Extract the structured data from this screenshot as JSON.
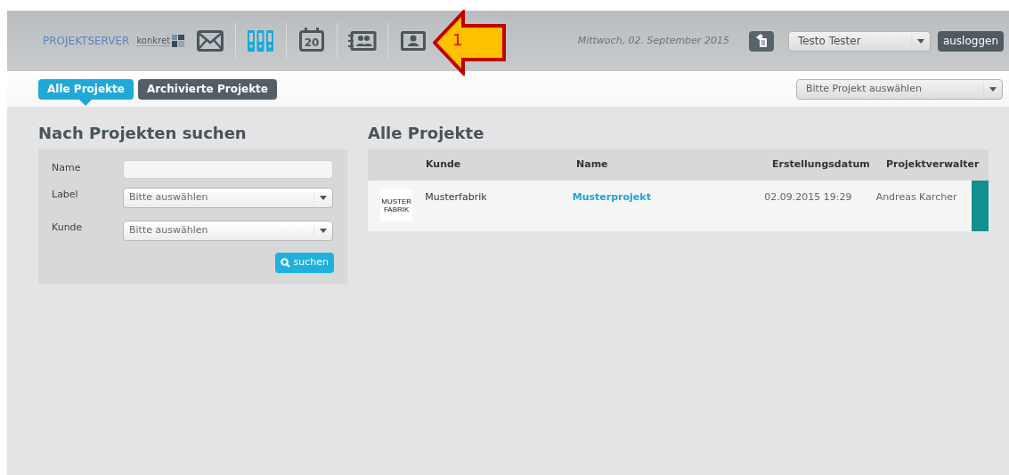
{
  "header": {
    "brand": "PROJEKTSERVER",
    "brand_logo": "konkret",
    "nav": [
      {
        "kind": "mail",
        "selected": false
      },
      {
        "kind": "binders",
        "selected": true
      },
      {
        "kind": "calendar",
        "label": "20",
        "selected": false
      },
      {
        "kind": "contacts",
        "selected": false
      },
      {
        "kind": "profile",
        "selected": false
      }
    ],
    "date": "Mittwoch, 02. September 2015",
    "user": "Testo Tester",
    "logout": "ausloggen"
  },
  "annotation": {
    "label": "1"
  },
  "tabs": [
    {
      "label": "Alle Projekte",
      "selected": true
    },
    {
      "label": "Archivierte Projekte",
      "selected": false
    }
  ],
  "project_select": {
    "placeholder": "Bitte Projekt auswählen"
  },
  "search": {
    "title": "Nach Projekten suchen",
    "fields": [
      {
        "kind": "text",
        "label": "Name"
      },
      {
        "kind": "select",
        "label": "Label",
        "placeholder": "Bitte auswählen"
      },
      {
        "kind": "select",
        "label": "Kunde",
        "placeholder": "Bitte auswählen"
      }
    ],
    "button": "suchen"
  },
  "table": {
    "title": "Alle Projekte",
    "columns": [
      "Kunde",
      "Name",
      "Erstellungsdatum",
      "Projektverwalter"
    ],
    "rows": [
      {
        "logo": "MUSTER FABRIK",
        "customer": "Musterfabrik",
        "name": "Musterprojekt",
        "date": "02.09.2015 19:29",
        "manager": "Andreas Karcher",
        "color": "#128f8f"
      }
    ]
  }
}
